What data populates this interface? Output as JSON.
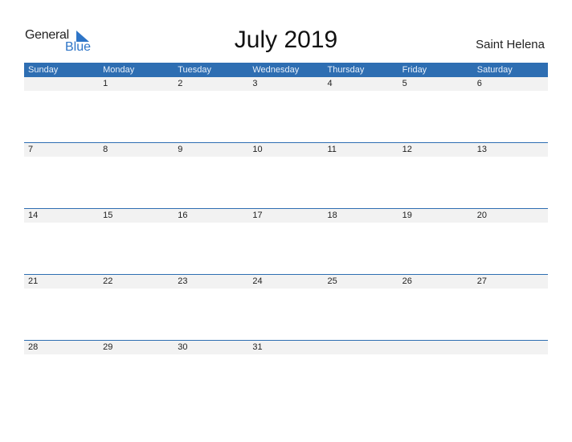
{
  "logo": {
    "general": "General",
    "blue": "Blue",
    "accent": "#2e75c7"
  },
  "title": "July 2019",
  "country": "Saint Helena",
  "colors": {
    "header_bg": "#2e6eb2",
    "band_bg": "#f2f2f2"
  },
  "weekdays": [
    "Sunday",
    "Monday",
    "Tuesday",
    "Wednesday",
    "Thursday",
    "Friday",
    "Saturday"
  ],
  "weeks": [
    [
      "",
      "1",
      "2",
      "3",
      "4",
      "5",
      "6"
    ],
    [
      "7",
      "8",
      "9",
      "10",
      "11",
      "12",
      "13"
    ],
    [
      "14",
      "15",
      "16",
      "17",
      "18",
      "19",
      "20"
    ],
    [
      "21",
      "22",
      "23",
      "24",
      "25",
      "26",
      "27"
    ],
    [
      "28",
      "29",
      "30",
      "31",
      "",
      "",
      ""
    ]
  ]
}
